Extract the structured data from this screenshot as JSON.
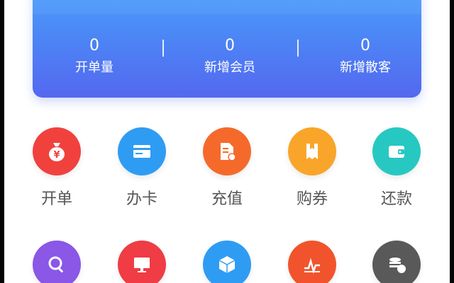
{
  "stats": [
    {
      "value": "0",
      "label": "开单量"
    },
    {
      "value": "0",
      "label": "新增会员"
    },
    {
      "value": "0",
      "label": "新增散客"
    }
  ],
  "actions": [
    {
      "label": "开单",
      "icon": "money-bag-icon",
      "color": "#f1413d"
    },
    {
      "label": "办卡",
      "icon": "card-icon",
      "color": "#2f9cf3"
    },
    {
      "label": "充值",
      "icon": "recharge-document-icon",
      "color": "#f56a2b"
    },
    {
      "label": "购券",
      "icon": "coupon-icon",
      "color": "#f9a52a"
    },
    {
      "label": "还款",
      "icon": "wallet-icon",
      "color": "#27c8c2"
    }
  ],
  "actions_row2": [
    {
      "icon": "search-person-icon",
      "color": "#8a57e6"
    },
    {
      "icon": "monitor-icon",
      "color": "#ef3c45"
    },
    {
      "icon": "box-icon",
      "color": "#2f9cf3"
    },
    {
      "icon": "trend-chart-icon",
      "color": "#f1542c"
    },
    {
      "icon": "coins-icon",
      "color": "#595959"
    }
  ]
}
